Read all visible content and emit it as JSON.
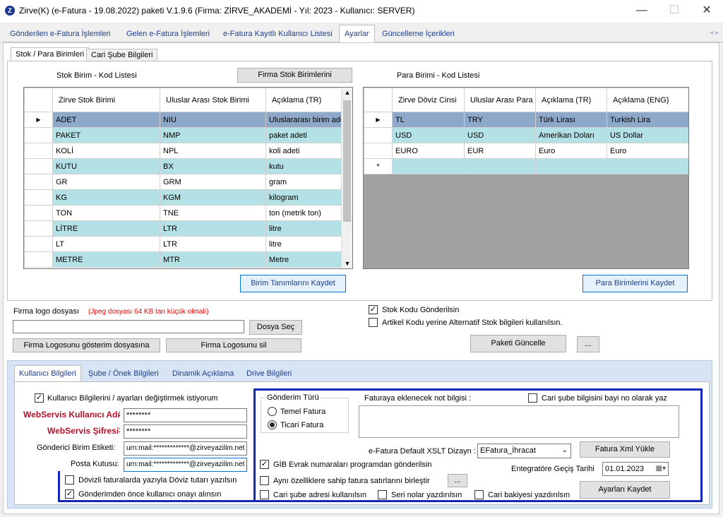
{
  "window": {
    "title": "Zirve(K)  (e-Fatura - 19.08.2022) paketi V.1.9.6 (Firma: ZİRVE_AKADEMİ - Yıl: 2023 - Kullanıcı: SERVER)",
    "icon_letter": "Z",
    "min": "—",
    "max": "☐",
    "close": "✕"
  },
  "main_tabs": [
    "Gönderilen e-Fatura İşlemleri",
    "Gelen e-Fatura İşlemleri",
    "e-Fatura Kayıtlı Kullanıcı Listesi",
    "Ayarlar",
    "Güncelleme İçerikleri"
  ],
  "tab_scroll": "◂ ▸",
  "sub_tabs": [
    "Stok / Para Birimleri",
    "Cari Şube Bilgileri"
  ],
  "stock": {
    "title": "Stok Birim - Kod Listesi",
    "firm_button": "Firma Stok Birimlerini",
    "columns": [
      "Zirve Stok Birimi",
      "Uluslar Arası Stok Birimi",
      "Açıklama (TR)"
    ],
    "rows": [
      [
        "ADET",
        "NIU",
        "Uluslararası birim adet"
      ],
      [
        "PAKET",
        "NMP",
        "paket adeti"
      ],
      [
        "KOLİ",
        "NPL",
        "koli adeti"
      ],
      [
        "KUTU",
        "BX",
        "kutu"
      ],
      [
        "GR",
        "GRM",
        "gram"
      ],
      [
        "KG",
        "KGM",
        "kilogram"
      ],
      [
        "TON",
        "TNE",
        "ton (metrik ton)"
      ],
      [
        "LİTRE",
        "LTR",
        "litre"
      ],
      [
        "LT",
        "LTR",
        "litre"
      ],
      [
        "METRE",
        "MTR",
        "Metre"
      ]
    ],
    "save_button": "Birim Tanımlarını Kaydet"
  },
  "currency": {
    "title": "Para Birimi - Kod Listesi",
    "columns": [
      "Zirve Döviz Cinsi",
      "Uluslar Arası Para Birimi",
      "Açıklama (TR)",
      "Açıklama (ENG)"
    ],
    "rows": [
      [
        "TL",
        "TRY",
        "Türk Lirası",
        "Turkish Lira"
      ],
      [
        "USD",
        "USD",
        "Amerikan Doları",
        "US Dollar"
      ],
      [
        "EURO",
        "EUR",
        "Euro",
        "Euro"
      ]
    ],
    "new_row_marker": "*",
    "save_button": "Para Birimlerini Kaydet"
  },
  "logo": {
    "label": "Firma logo dosyası",
    "hint": "(Jpeg dosyası 64 KB tan küçük olmalı)",
    "path": "",
    "choose_button": "Dosya Seç",
    "copy_button": "Firma Logosunu gösterim dosyasına",
    "delete_button": "Firma Logosunu sil"
  },
  "options": {
    "stock_code_send": "Stok Kodu Gönderilsin",
    "alt_stock": "Artikel Kodu yerine Alternatif Stok bilgileri kullanılsın.",
    "update_button": "Paketi Güncelle",
    "more_button": "..."
  },
  "bottom_tabs": [
    "Kullanıcı Bilgileri",
    "Şube / Önek Bilgileri",
    "Dinamik Açıklama",
    "Drive Bilgileri"
  ],
  "user": {
    "change_check": "Kullanıcı Bilgilerini / ayarları değiştirmek istiyorum",
    "ws_user_label": "WebServis Kullanıcı Adı",
    "ws_user_value": "********",
    "ws_pass_label": "WebServis Şifresi",
    "ws_pass_value": "********",
    "colon": ":",
    "sender_label": "Gönderici Birim Etiketi:",
    "sender_value": "urn:mail:*************@zirveyazilim.net",
    "mailbox_label": "Posta Kutusu:",
    "mailbox_value": "urn:mail:*************@zirveyazilim.net"
  },
  "invoice": {
    "type_title": "Gönderim Türü",
    "type_basic": "Temel Fatura",
    "type_commercial": "Ticari Fatura",
    "note_label": "Faturaya eklenecek not bilgisi :",
    "branch_dealer": "Cari şube bilgisini bayi no olarak yaz",
    "xslt_label": "e-Fatura Default XSLT Dizayn :",
    "xslt_value": "EFatura_İhracat",
    "xml_button": "Fatura Xml Yükle",
    "gib_check": "GİB Evrak numaraları programdan gönderilsin",
    "transition_label": "Entegratöre Geçiş Tarihi",
    "transition_date": "01.01.2023",
    "merge_check": "Aynı özelliklere sahip fatura satırlarını birleştir",
    "merge_more": "...",
    "branch_address": "Cari şube adresi kullanılsın",
    "serial_print": "Seri nolar yazdırılsın",
    "balance_print": "Cari bakiyesi yazdırılsın",
    "save_button": "Ayarları Kaydet",
    "fx_amount": "Dövizli faturalarda yazıyla Döviz tutarı yazılsın",
    "approval": "Gönderimden önce kullanıcı onayı alınsın"
  }
}
